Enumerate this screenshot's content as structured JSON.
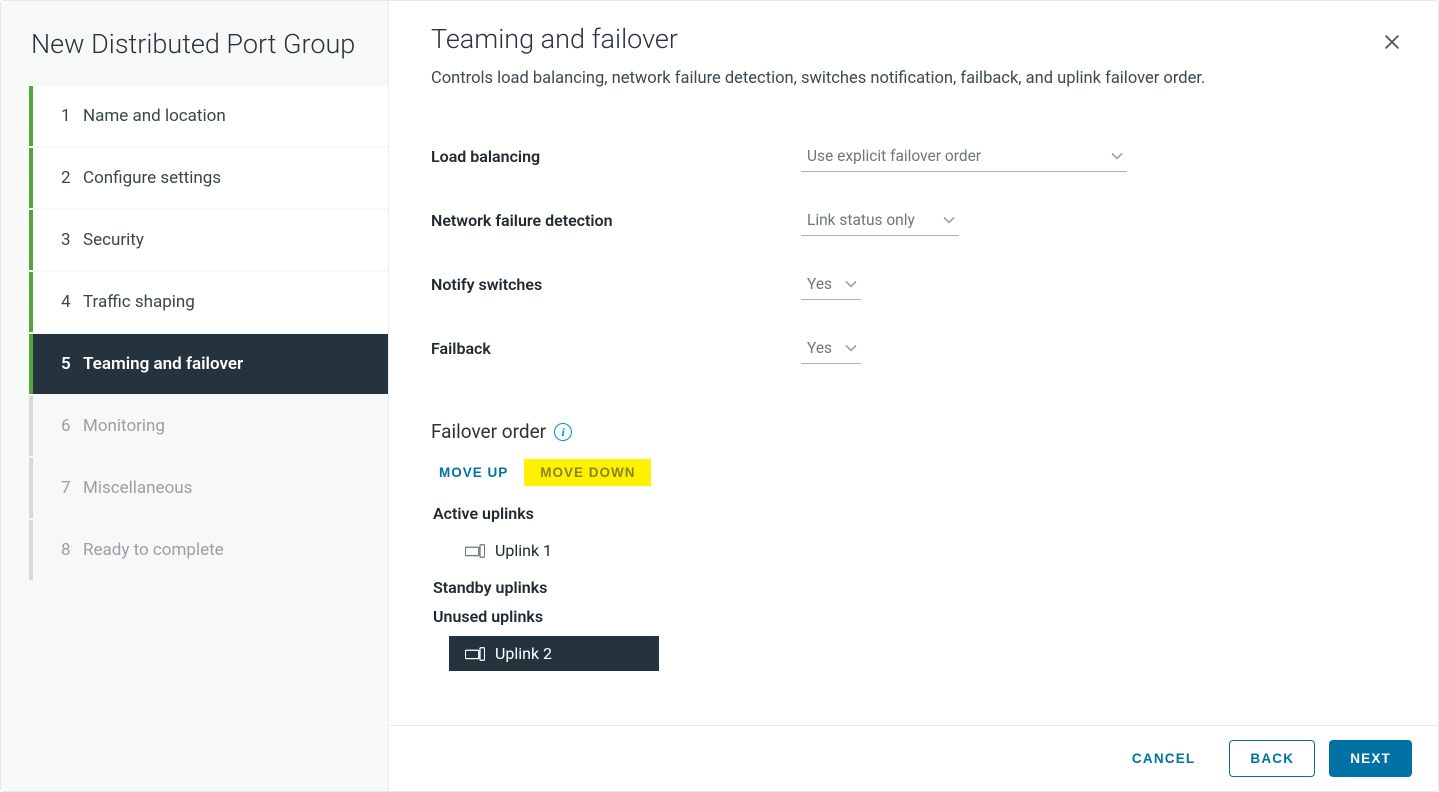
{
  "sidebar": {
    "title": "New Distributed Port Group",
    "steps": [
      {
        "num": "1",
        "label": "Name and location",
        "state": "completed"
      },
      {
        "num": "2",
        "label": "Configure settings",
        "state": "completed"
      },
      {
        "num": "3",
        "label": "Security",
        "state": "completed"
      },
      {
        "num": "4",
        "label": "Traffic shaping",
        "state": "completed"
      },
      {
        "num": "5",
        "label": "Teaming and failover",
        "state": "active"
      },
      {
        "num": "6",
        "label": "Monitoring",
        "state": "pending"
      },
      {
        "num": "7",
        "label": "Miscellaneous",
        "state": "pending"
      },
      {
        "num": "8",
        "label": "Ready to complete",
        "state": "pending"
      }
    ]
  },
  "page": {
    "title": "Teaming and failover",
    "description": "Controls load balancing, network failure detection, switches notification, failback, and uplink failover order."
  },
  "form": {
    "load_balancing": {
      "label": "Load balancing",
      "value": "Use explicit failover order"
    },
    "failure_detect": {
      "label": "Network failure detection",
      "value": "Link status only"
    },
    "notify_switches": {
      "label": "Notify switches",
      "value": "Yes"
    },
    "failback": {
      "label": "Failback",
      "value": "Yes"
    }
  },
  "failover": {
    "section_title": "Failover order",
    "move_up_label": "MOVE UP",
    "move_down_label": "MOVE DOWN",
    "groups": {
      "active": {
        "label": "Active uplinks",
        "items": [
          "Uplink 1"
        ]
      },
      "standby": {
        "label": "Standby uplinks",
        "items": []
      },
      "unused": {
        "label": "Unused uplinks",
        "items": [
          "Uplink 2"
        ]
      }
    },
    "selected_item": "Uplink 2"
  },
  "footer": {
    "cancel": "CANCEL",
    "back": "BACK",
    "next": "NEXT"
  }
}
